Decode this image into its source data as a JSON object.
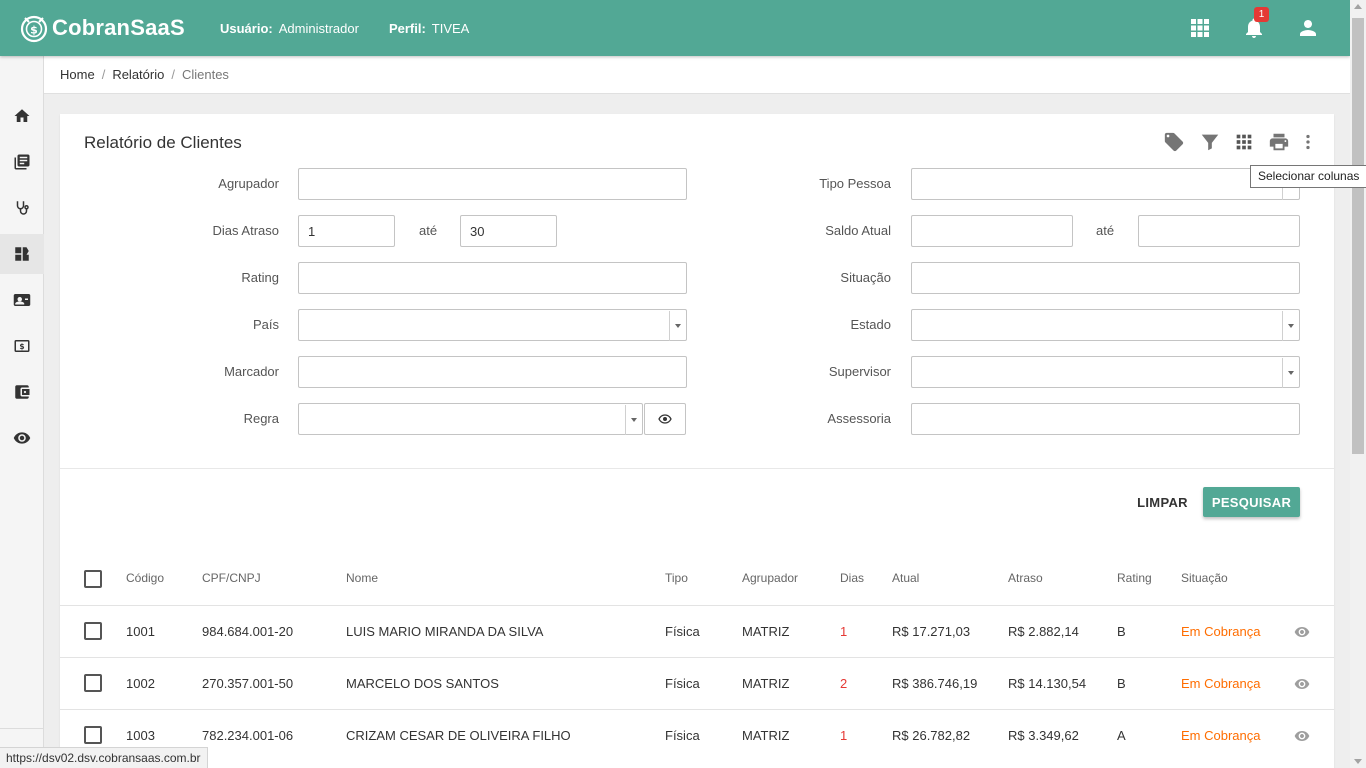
{
  "header": {
    "brand": "CobranSaaS",
    "user_label": "Usuário:",
    "user_value": "Administrador",
    "profile_label": "Perfil:",
    "profile_value": "TIVEA",
    "notifications_count": "1",
    "icons": [
      "apps-grid-icon",
      "bell-icon",
      "account-icon"
    ]
  },
  "sidebar": {
    "items": [
      {
        "icon": "home-icon"
      },
      {
        "icon": "book-icon"
      },
      {
        "icon": "stethoscope-icon"
      },
      {
        "icon": "dashboard-icon"
      },
      {
        "icon": "contact-card-icon"
      },
      {
        "icon": "dollar-icon"
      },
      {
        "icon": "wallet-icon"
      },
      {
        "icon": "eye-icon"
      }
    ],
    "active_index": 3
  },
  "breadcrumb": {
    "items": [
      "Home",
      "Relatório"
    ],
    "current": "Clientes",
    "separator": "/"
  },
  "card": {
    "title": "Relatório de Clientes",
    "tool_icons": [
      "tag-icon",
      "filter-icon",
      "columns-grid-icon",
      "print-icon",
      "more-vert-icon"
    ],
    "tooltip": "Selecionar colunas"
  },
  "filters": {
    "agrupador": {
      "label": "Agrupador",
      "value": ""
    },
    "dias_atraso": {
      "label": "Dias Atraso",
      "from": "1",
      "to_label": "até",
      "to": "30"
    },
    "rating": {
      "label": "Rating",
      "value": ""
    },
    "pais": {
      "label": "País",
      "value": ""
    },
    "marcador": {
      "label": "Marcador",
      "value": ""
    },
    "regra": {
      "label": "Regra",
      "value": ""
    },
    "tipo_pessoa": {
      "label": "Tipo Pessoa",
      "value": ""
    },
    "saldo_atual": {
      "label": "Saldo Atual",
      "from": "",
      "to_label": "até",
      "to": ""
    },
    "situacao": {
      "label": "Situação",
      "value": ""
    },
    "estado": {
      "label": "Estado",
      "value": ""
    },
    "supervisor": {
      "label": "Supervisor",
      "value": ""
    },
    "assessoria": {
      "label": "Assessoria",
      "value": ""
    }
  },
  "actions": {
    "clear_label": "LIMPAR",
    "search_label": "PESQUISAR"
  },
  "table": {
    "columns": [
      "Código",
      "CPF/CNPJ",
      "Nome",
      "Tipo",
      "Agrupador",
      "Dias",
      "Atual",
      "Atraso",
      "Rating",
      "Situação"
    ],
    "rows": [
      {
        "codigo": "1001",
        "cpf": "984.684.001-20",
        "nome": "LUIS MARIO MIRANDA DA SILVA",
        "tipo": "Física",
        "agrupador": "MATRIZ",
        "dias": "1",
        "atual": "R$ 17.271,03",
        "atraso": "R$ 2.882,14",
        "rating": "B",
        "situacao": "Em Cobrança"
      },
      {
        "codigo": "1002",
        "cpf": "270.357.001-50",
        "nome": "MARCELO DOS SANTOS",
        "tipo": "Física",
        "agrupador": "MATRIZ",
        "dias": "2",
        "atual": "R$ 386.746,19",
        "atraso": "R$ 14.130,54",
        "rating": "B",
        "situacao": "Em Cobrança"
      },
      {
        "codigo": "1003",
        "cpf": "782.234.001-06",
        "nome": "CRIZAM CESAR DE OLIVEIRA FILHO",
        "tipo": "Física",
        "agrupador": "MATRIZ",
        "dias": "1",
        "atual": "R$ 26.782,82",
        "atraso": "R$ 3.349,62",
        "rating": "A",
        "situacao": "Em Cobrança"
      }
    ]
  },
  "status_bar": {
    "url": "https://dsv02.dsv.cobransaas.com.br"
  },
  "colors": {
    "brand": "#52a895",
    "days_red": "#e53935",
    "status_orange": "#ff6d00"
  }
}
